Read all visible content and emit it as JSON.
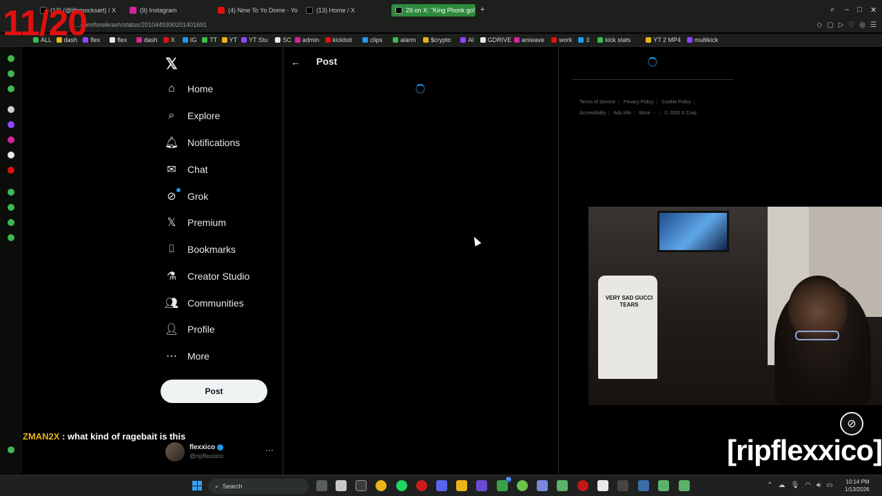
{
  "overlay": {
    "counter": "11/20",
    "chat_user": "ZMAN2X",
    "chat_message": ": what kind of ragebait is this",
    "watermark": "[ripflexxico]"
  },
  "browser": {
    "tabs": [
      {
        "label": "(13) (@lifemocksart) / X",
        "icon": "x-icon",
        "active": false
      },
      {
        "label": "(9) Instagram",
        "icon": "instagram-icon",
        "active": false
      },
      {
        "label": "(4) Nine To Yo Dome - Yo",
        "icon": "youtube-icon",
        "active": false
      },
      {
        "label": "(13) Home / X",
        "icon": "x-icon",
        "active": false
      },
      {
        "label": "29 on X: \"King Phonk go!",
        "icon": "x-icon",
        "active": true
      }
    ],
    "url": "…com/foreikrash/status/2010449390201401691",
    "bookmarks": [
      "ALL",
      "dash",
      "flex",
      "flex",
      "dash",
      "X",
      "IG",
      "TT",
      "YT",
      "YT Stu",
      "SC",
      "admin",
      "kickbot",
      "clips",
      "alarm",
      "$crypto",
      "AI",
      "GDRIVE",
      "aniwave",
      "work",
      "3",
      "kick stats",
      "YT 2 MP4",
      "multikick"
    ],
    "colors": {
      "active_tab": "#2d8a3c",
      "chrome_bg": "#1c1f1c"
    }
  },
  "nav": {
    "items": [
      {
        "label": "Home",
        "icon": "home-icon"
      },
      {
        "label": "Explore",
        "icon": "search-icon"
      },
      {
        "label": "Notifications",
        "icon": "bell-icon"
      },
      {
        "label": "Chat",
        "icon": "mail-icon"
      },
      {
        "label": "Grok",
        "icon": "grok-icon"
      },
      {
        "label": "Premium",
        "icon": "x-logo-icon"
      },
      {
        "label": "Bookmarks",
        "icon": "bookmark-icon"
      },
      {
        "label": "Creator Studio",
        "icon": "flask-icon"
      },
      {
        "label": "Communities",
        "icon": "people-icon"
      },
      {
        "label": "Profile",
        "icon": "person-icon"
      },
      {
        "label": "More",
        "icon": "more-circle-icon"
      }
    ],
    "post_label": "Post"
  },
  "account": {
    "name": "flexxico",
    "handle": "@ripflexxico"
  },
  "main": {
    "title": "Post",
    "loading": true
  },
  "footer": {
    "links": [
      "Terms of Service",
      "Privacy Policy",
      "Cookie Policy",
      "Accessibility",
      "Ads info",
      "More ···",
      "© 2026 X Corp."
    ]
  },
  "webcam": {
    "shirt_text": "VERY SAD GUCCI TEARS"
  },
  "taskbar": {
    "search_label": "Search",
    "time": "10:14 PM",
    "date": "1/13/2026",
    "badge_count": "13"
  }
}
